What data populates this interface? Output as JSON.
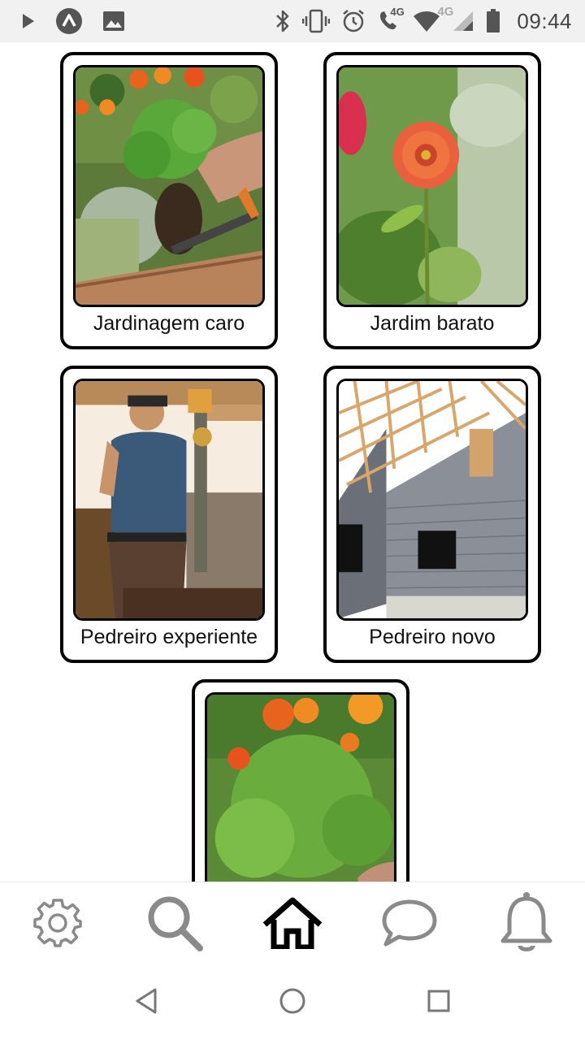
{
  "status_bar": {
    "time": "09:44",
    "network_label_1": "4G",
    "network_label_2": "4G",
    "icons": [
      "play-store-icon",
      "app-icon",
      "gallery-icon",
      "bluetooth-icon",
      "vibrate-icon",
      "alarm-icon",
      "volte-call-icon",
      "wifi-icon",
      "cell-signal-icon",
      "battery-icon"
    ]
  },
  "cards": [
    {
      "label": "Jardinagem caro",
      "image": "gardening-planting-photo"
    },
    {
      "label": "Jardim barato",
      "image": "red-zinnia-flower-photo"
    },
    {
      "label": "Pedreiro experiente",
      "image": "mason-with-drill-photo"
    },
    {
      "label": "Pedreiro novo",
      "image": "house-under-construction-photo"
    },
    {
      "label": "",
      "image": "marigold-plants-photo"
    }
  ],
  "bottom_nav": [
    {
      "name": "settings",
      "icon": "gear-icon",
      "active": false
    },
    {
      "name": "search",
      "icon": "search-icon",
      "active": false
    },
    {
      "name": "home",
      "icon": "home-icon",
      "active": true
    },
    {
      "name": "messages",
      "icon": "chat-bubble-icon",
      "active": false
    },
    {
      "name": "notifications",
      "icon": "bell-icon",
      "active": false
    }
  ],
  "system_nav": [
    "back-icon",
    "home-circle-icon",
    "recents-icon"
  ],
  "colors": {
    "nav_inactive": "#888888",
    "nav_active": "#000000",
    "card_border": "#000000"
  }
}
